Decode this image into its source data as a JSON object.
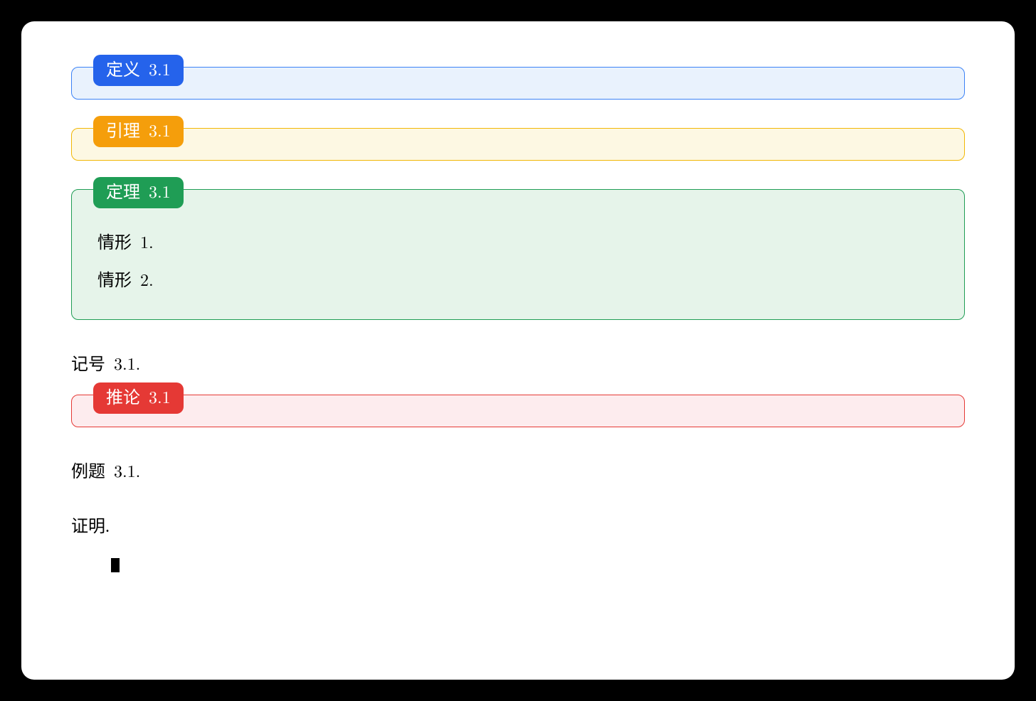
{
  "definition": {
    "label": "定义",
    "number": "3.1"
  },
  "lemma": {
    "label": "引理",
    "number": "3.1"
  },
  "theorem": {
    "label": "定理",
    "number": "3.1",
    "cases": [
      {
        "label": "情形",
        "number": "1."
      },
      {
        "label": "情形",
        "number": "2."
      }
    ]
  },
  "notation": {
    "label": "记号",
    "number": "3.1."
  },
  "corollary": {
    "label": "推论",
    "number": "3.1"
  },
  "example": {
    "label": "例题",
    "number": "3.1."
  },
  "proof": {
    "label": "证明."
  }
}
